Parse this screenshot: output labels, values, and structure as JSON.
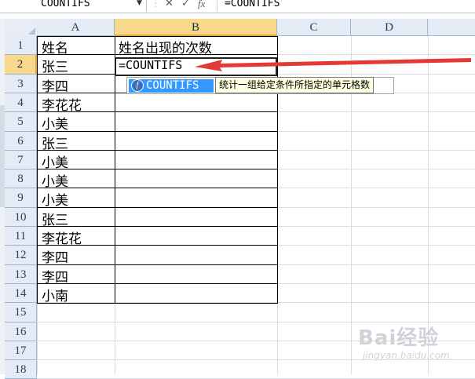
{
  "formula_bar": {
    "name_box": "COUNTIFS",
    "cancel_glyph": "✕",
    "confirm_glyph": "✓",
    "fx_label": "fx",
    "formula": "=COUNTIFS"
  },
  "columns": [
    {
      "label": "A",
      "active": false
    },
    {
      "label": "B",
      "active": true
    },
    {
      "label": "C",
      "active": false
    },
    {
      "label": "D",
      "active": false
    }
  ],
  "rows": [
    {
      "num": "1",
      "a": "姓名",
      "b": "姓名出现的次数"
    },
    {
      "num": "2",
      "a": "张三",
      "b": "=COUNTIFS"
    },
    {
      "num": "3",
      "a": "李四",
      "b": ""
    },
    {
      "num": "4",
      "a": "李花花",
      "b": ""
    },
    {
      "num": "5",
      "a": "小美",
      "b": ""
    },
    {
      "num": "6",
      "a": "张三",
      "b": ""
    },
    {
      "num": "7",
      "a": "小美",
      "b": ""
    },
    {
      "num": "8",
      "a": "小美",
      "b": ""
    },
    {
      "num": "9",
      "a": "小美",
      "b": ""
    },
    {
      "num": "10",
      "a": "张三",
      "b": ""
    },
    {
      "num": "11",
      "a": "李花花",
      "b": ""
    },
    {
      "num": "12",
      "a": "李四",
      "b": ""
    },
    {
      "num": "13",
      "a": "李四",
      "b": ""
    },
    {
      "num": "14",
      "a": "小南",
      "b": ""
    },
    {
      "num": "15",
      "a": "",
      "b": ""
    },
    {
      "num": "16",
      "a": "",
      "b": ""
    },
    {
      "num": "17",
      "a": "",
      "b": ""
    },
    {
      "num": "18",
      "a": "",
      "b": ""
    }
  ],
  "active_row": "2",
  "autocomplete": {
    "function_name": "COUNTIFS",
    "description": "统计一组给定条件所指定的单元格数"
  },
  "watermark": {
    "logo": "Bai经验",
    "url": "jingyan.baidu.com"
  },
  "colors": {
    "header_bg": "#e4ebf4",
    "active_header_bg": "#f8d98c",
    "autocomplete_highlight": "#3399ff",
    "annotation_arrow": "#e53935"
  },
  "icons": [
    "fx-icon",
    "cancel-icon",
    "confirm-icon",
    "dropdown-arrow-icon",
    "select-all-icon",
    "annotation-arrow"
  ]
}
